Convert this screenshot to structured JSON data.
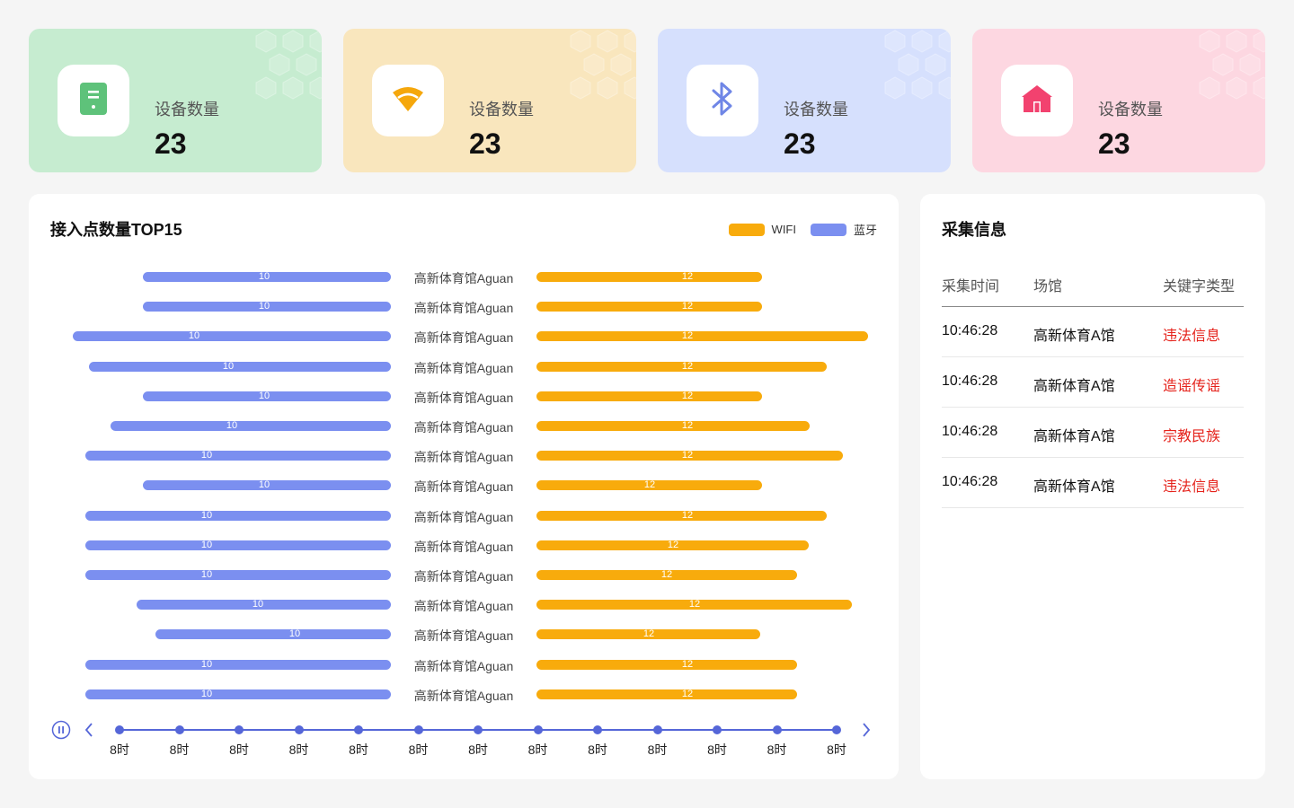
{
  "stats": [
    {
      "label": "设备数量",
      "value": "23",
      "icon": "server-icon",
      "bg": "#c6ecd0",
      "color": "#5ec27a"
    },
    {
      "label": "设备数量",
      "value": "23",
      "icon": "wifi-icon",
      "bg": "#f9e6bd",
      "color": "#f5a70c"
    },
    {
      "label": "设备数量",
      "value": "23",
      "icon": "bluetooth-icon",
      "bg": "#d6e0fd",
      "color": "#6f86e6"
    },
    {
      "label": "设备数量",
      "value": "23",
      "icon": "home-icon",
      "bg": "#fdd7e1",
      "color": "#f2426f"
    }
  ],
  "chart_panel": {
    "title": "接入点数量TOP15",
    "legend": [
      {
        "name": "WIFI",
        "color": "#f8ab0c"
      },
      {
        "name": "蓝牙",
        "color": "#7b8ff0"
      }
    ]
  },
  "chart_data": {
    "type": "bar",
    "title": "接入点数量TOP15",
    "categories": [
      "高新体育馆Aguan",
      "高新体育馆Aguan",
      "高新体育馆Aguan",
      "高新体育馆Aguan",
      "高新体育馆Aguan",
      "高新体育馆Aguan",
      "高新体育馆Aguan",
      "高新体育馆Aguan",
      "高新体育馆Aguan",
      "高新体育馆Aguan",
      "高新体育馆Aguan",
      "高新体育馆Aguan",
      "高新体育馆Aguan",
      "高新体育馆Aguan",
      "高新体育馆Aguan"
    ],
    "series": [
      {
        "name": "蓝牙",
        "labels": [
          "10",
          "10",
          "10",
          "10",
          "10",
          "10",
          "10",
          "10",
          "10",
          "10",
          "10",
          "10",
          "10",
          "10",
          "10"
        ],
        "bar_fraction": [
          0.78,
          0.78,
          1.0,
          0.95,
          0.78,
          0.88,
          0.96,
          0.78,
          0.96,
          0.96,
          0.96,
          0.8,
          0.74,
          0.96,
          0.96
        ]
      },
      {
        "name": "WIFI",
        "labels": [
          "12",
          "12",
          "12",
          "12",
          "12",
          "12",
          "12",
          "12",
          "12",
          "12",
          "12",
          "12",
          "12",
          "12",
          "12"
        ],
        "bar_fraction": [
          0.68,
          0.68,
          1.0,
          0.875,
          0.68,
          0.825,
          0.925,
          0.68,
          0.875,
          0.82,
          0.785,
          0.95,
          0.675,
          0.785,
          0.785
        ]
      }
    ]
  },
  "timeline": {
    "labels": [
      "8时",
      "8时",
      "8时",
      "8时",
      "8时",
      "8时",
      "8时",
      "8时",
      "8时",
      "8时",
      "8时",
      "8时",
      "8时"
    ]
  },
  "info_panel": {
    "title": "采集信息",
    "headers": [
      "采集时间",
      "场馆",
      "关键字类型"
    ],
    "rows": [
      {
        "time": "10:46:28",
        "venue": "高新体育A馆",
        "keyword": "违法信息"
      },
      {
        "time": "10:46:28",
        "venue": "高新体育A馆",
        "keyword": "造谣传谣"
      },
      {
        "time": "10:46:28",
        "venue": "高新体育A馆",
        "keyword": "宗教民族"
      },
      {
        "time": "10:46:28",
        "venue": "高新体育A馆",
        "keyword": "违法信息"
      }
    ]
  }
}
